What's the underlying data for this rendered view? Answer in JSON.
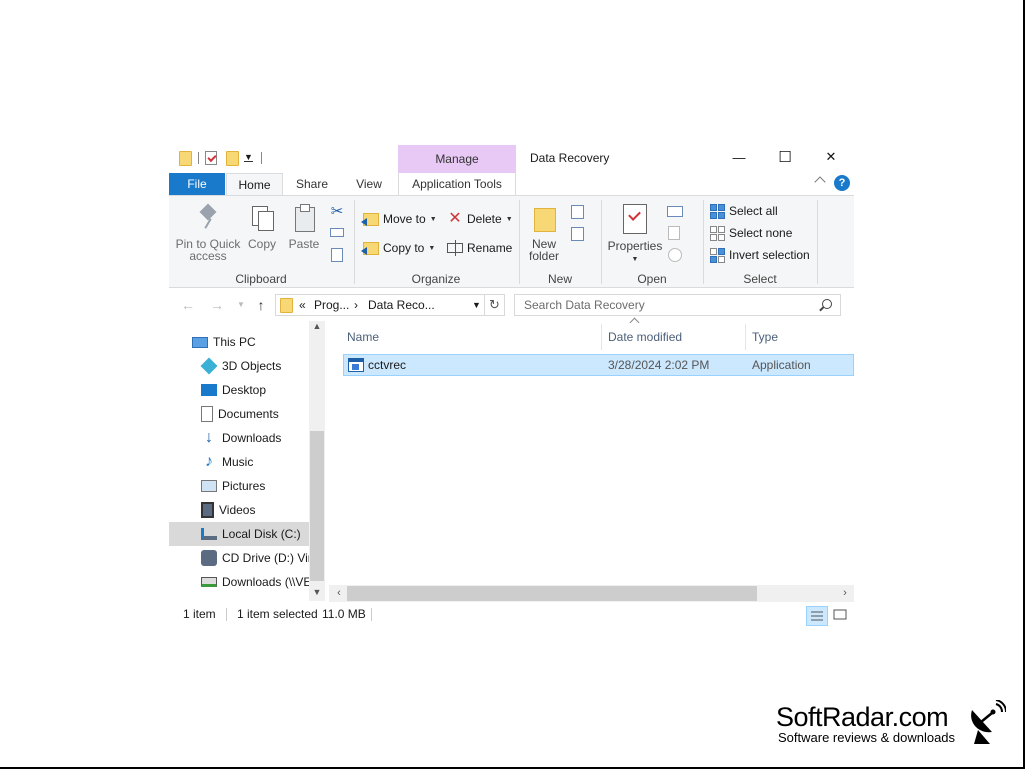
{
  "window": {
    "title": "Data Recovery",
    "context_tab": "Manage",
    "controls": {
      "minimize": "—",
      "maximize": "☐",
      "close": "✕"
    }
  },
  "tabs": [
    {
      "label": "File"
    },
    {
      "label": "Home"
    },
    {
      "label": "Share"
    },
    {
      "label": "View"
    },
    {
      "label": "Application Tools"
    }
  ],
  "ribbon": {
    "clipboard": {
      "label": "Clipboard",
      "pin_line1": "Pin to Quick",
      "pin_line2": "access",
      "copy": "Copy",
      "paste": "Paste"
    },
    "organize": {
      "label": "Organize",
      "move_to": "Move to",
      "copy_to": "Copy to",
      "delete": "Delete",
      "rename": "Rename"
    },
    "new": {
      "label": "New",
      "new_folder_line1": "New",
      "new_folder_line2": "folder"
    },
    "open": {
      "label": "Open",
      "properties": "Properties"
    },
    "select": {
      "label": "Select",
      "select_all": "Select all",
      "select_none": "Select none",
      "invert": "Invert selection"
    }
  },
  "address": {
    "overflow": "«",
    "crumbs": [
      "Prog...",
      "Data Reco..."
    ],
    "separator": "›",
    "search_placeholder": "Search Data Recovery"
  },
  "nav_pane": {
    "items": [
      {
        "label": "This PC",
        "icon": "pc-icon"
      },
      {
        "label": "3D Objects",
        "icon": "cube-icon"
      },
      {
        "label": "Desktop",
        "icon": "desktop-icon"
      },
      {
        "label": "Documents",
        "icon": "documents-icon"
      },
      {
        "label": "Downloads",
        "icon": "download-icon"
      },
      {
        "label": "Music",
        "icon": "music-icon"
      },
      {
        "label": "Pictures",
        "icon": "pictures-icon"
      },
      {
        "label": "Videos",
        "icon": "videos-icon"
      },
      {
        "label": "Local Disk (C:)",
        "icon": "disk-icon",
        "selected": true
      },
      {
        "label": "CD Drive (D:) Virt",
        "icon": "cd-drive-icon"
      },
      {
        "label": "Downloads (\\\\VE",
        "icon": "network-drive-icon"
      }
    ]
  },
  "file_list": {
    "columns": [
      "Name",
      "Date modified",
      "Type"
    ],
    "rows": [
      {
        "name": "cctvrec",
        "date": "3/28/2024 2:02 PM",
        "type": "Application",
        "selected": true
      }
    ]
  },
  "status": {
    "item_count": "1 item",
    "selected": "1 item selected",
    "size": "11.0 MB"
  },
  "watermark": {
    "name": "SoftRadar.com",
    "tagline": "Software reviews & downloads"
  },
  "colors": {
    "accent": "#1979ca",
    "manage_tab": "#e8c8f4",
    "selection": "#cce8ff",
    "ribbon_bg": "#f5f6f7"
  }
}
